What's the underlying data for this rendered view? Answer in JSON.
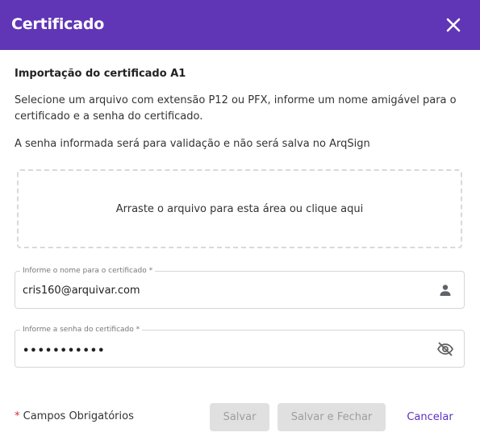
{
  "header": {
    "title": "Certificado",
    "close_icon": "close-icon",
    "background_color": "#6036b6"
  },
  "content": {
    "section_title": "Importação do certificado A1",
    "description": "Selecione um arquivo com extensão P12 ou PFX, informe um nome amigável para o certificado e a senha do certificado.",
    "note": "A senha informada será para validação e não será salva no ArqSign",
    "dropzone_text": "Arraste o arquivo para esta área ou clique aqui"
  },
  "fields": {
    "name": {
      "label": "Informe o nome para o certificado *",
      "value": "cris160@arquivar.com",
      "icon": "person-icon"
    },
    "password": {
      "label": "Informe a senha do certificado *",
      "value": "•••••••••••",
      "icon": "eye-off-icon"
    }
  },
  "footer": {
    "required_star": "*",
    "required_text": " Campos Obrigatórios",
    "save_label": "Salvar",
    "save_close_label": "Salvar e Fechar",
    "cancel_label": "Cancelar",
    "accent_color": "#5b2fc4"
  }
}
